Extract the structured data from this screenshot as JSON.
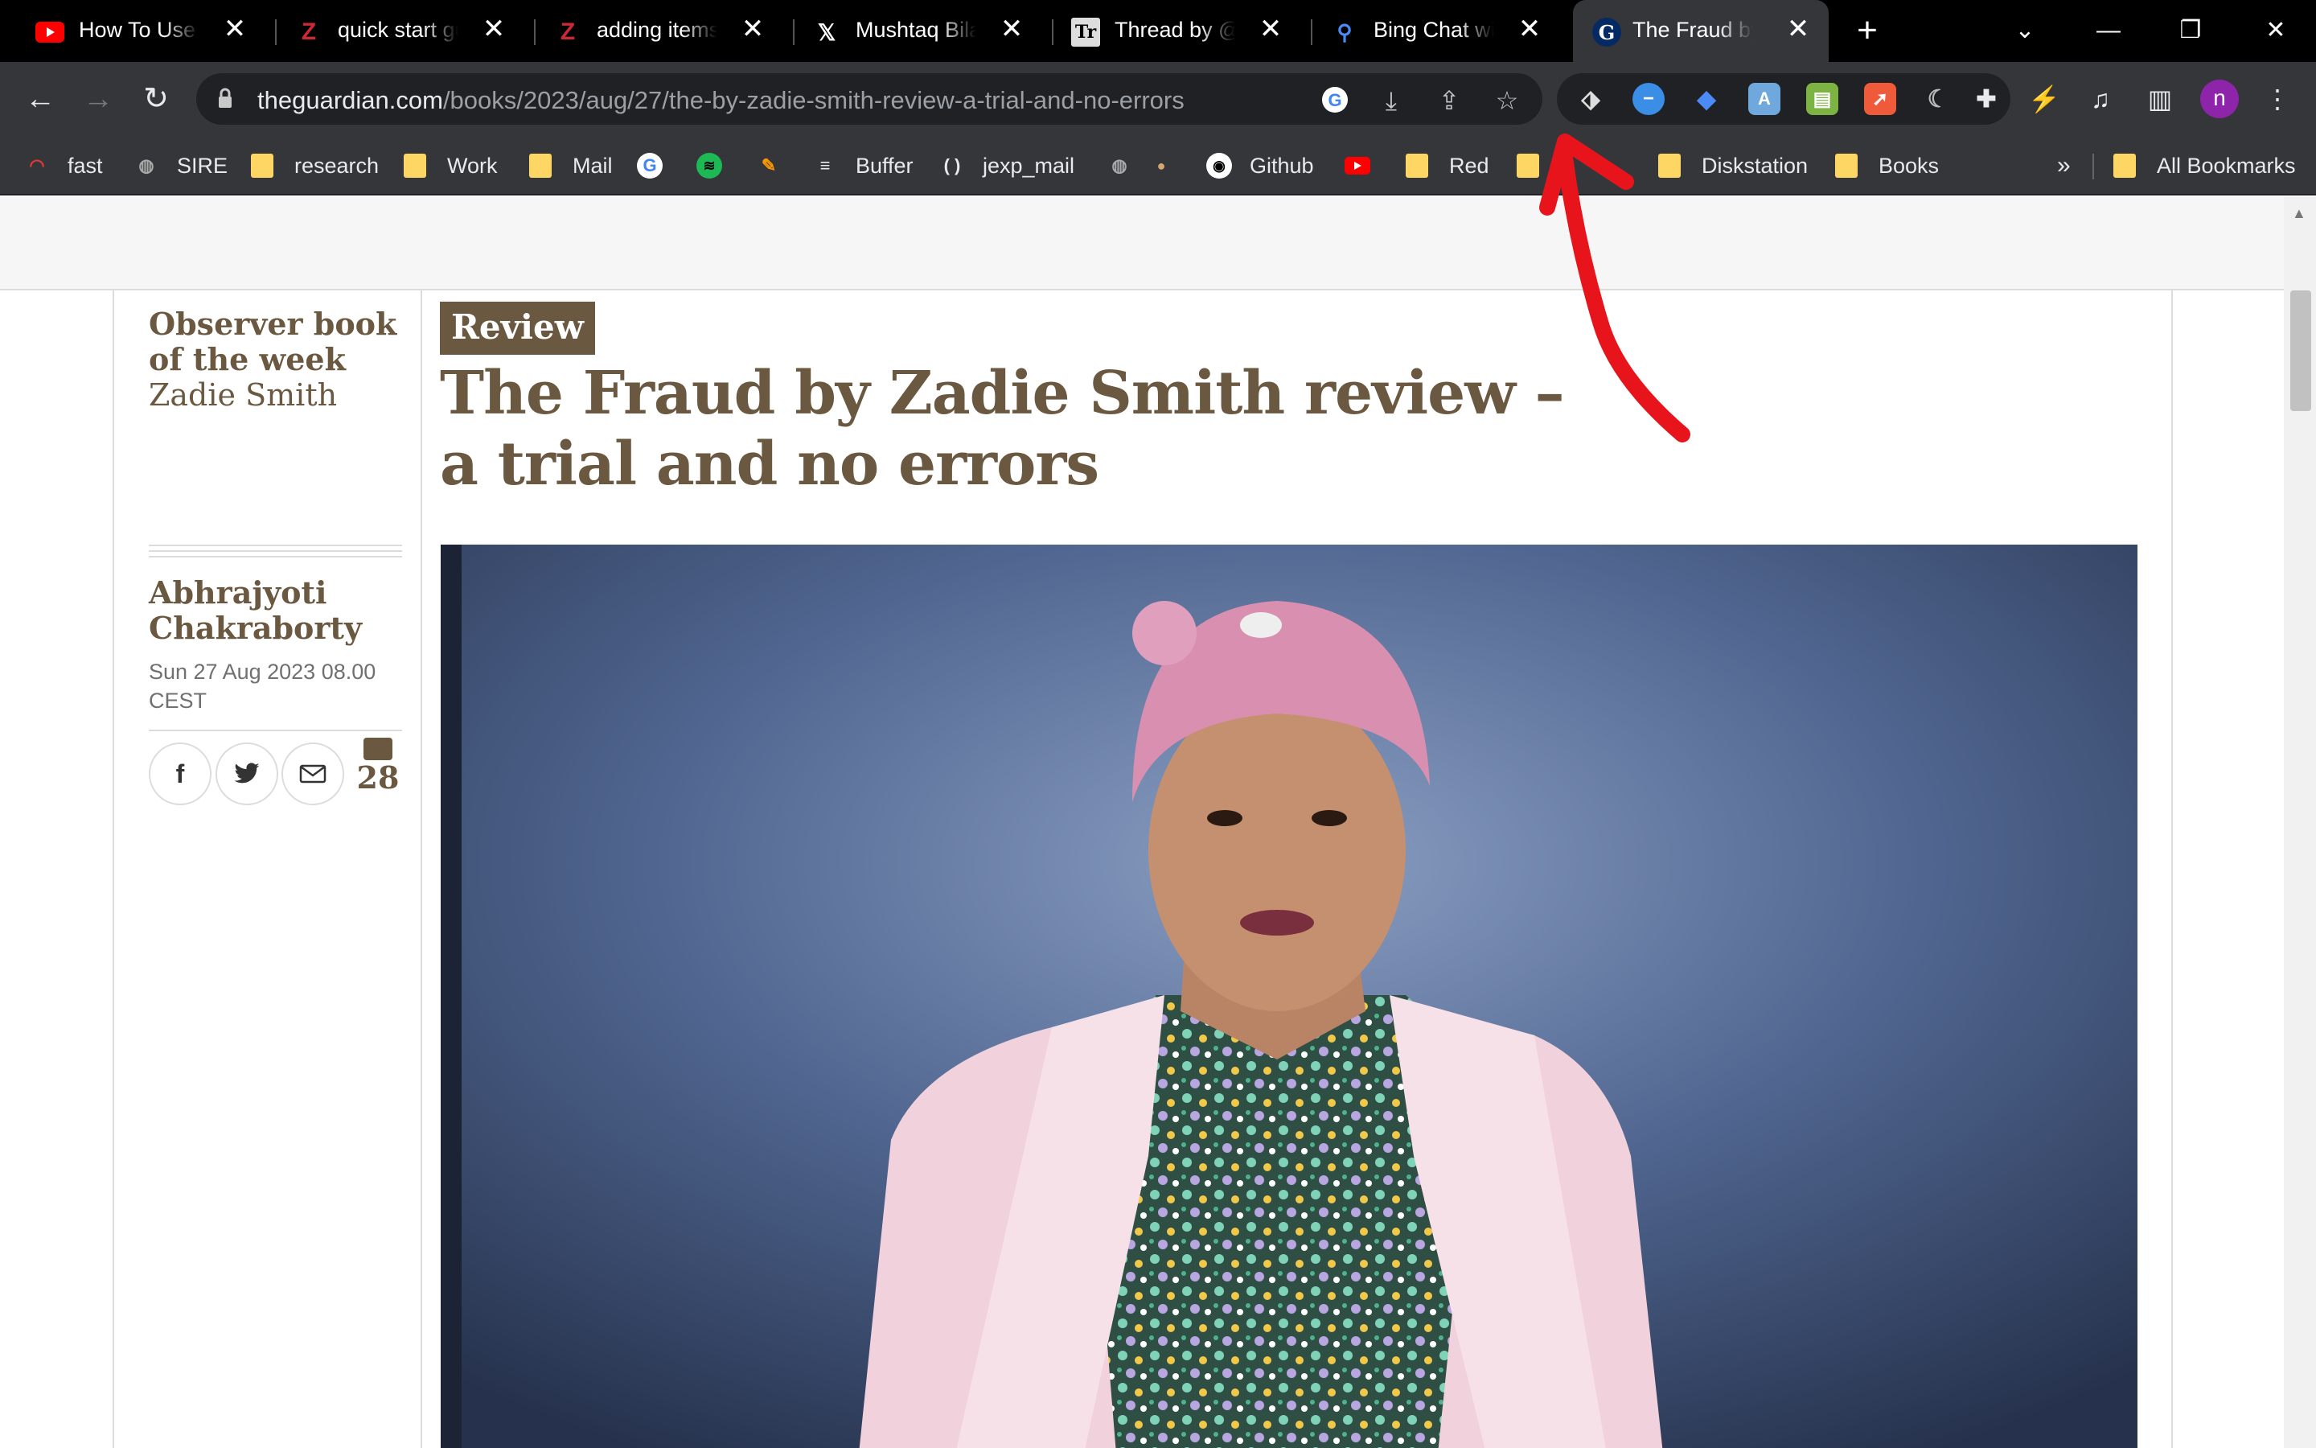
{
  "tabs": [
    {
      "title": "How To Use Zotero",
      "favicon": "youtube-icon",
      "active": false
    },
    {
      "title": "quick start guide",
      "favicon": "zotero-icon",
      "active": false
    },
    {
      "title": "adding items to",
      "favicon": "zotero-icon",
      "active": false
    },
    {
      "title": "Mushtaq Bilal,",
      "favicon": "x-icon",
      "active": false
    },
    {
      "title": "Thread by @M",
      "favicon": "threadreader-icon",
      "active": false
    },
    {
      "title": "Bing Chat with",
      "favicon": "bing-search-icon",
      "active": false
    },
    {
      "title": "The Fraud by Z",
      "favicon": "guardian-icon",
      "active": true
    }
  ],
  "address_bar": {
    "host": "theguardian.com",
    "path": "/books/2023/aug/27/the-by-zadie-smith-review-a-trial-and-no-errors"
  },
  "avatar_letter": "n",
  "bookmarks": [
    {
      "label": "fast",
      "icon": "speedometer-icon"
    },
    {
      "label": "SIRE",
      "icon": "globe-icon"
    },
    {
      "label": "research",
      "icon": "folder-icon"
    },
    {
      "label": "Work",
      "icon": "folder-icon"
    },
    {
      "label": "Mail",
      "icon": "folder-icon"
    },
    {
      "label": "",
      "icon": "google-icon"
    },
    {
      "label": "",
      "icon": "spotify-icon"
    },
    {
      "label": "",
      "icon": "pencil-icon"
    },
    {
      "label": "Buffer",
      "icon": "buffer-icon"
    },
    {
      "label": "jexp_mail",
      "icon": "brackets-icon"
    },
    {
      "label": "",
      "icon": "globe-icon"
    },
    {
      "label": "",
      "icon": "cookie-icon"
    },
    {
      "label": "Github",
      "icon": "github-icon"
    },
    {
      "label": "",
      "icon": "youtube-icon"
    },
    {
      "label": "Red",
      "icon": "folder-icon"
    },
    {
      "label": "",
      "icon": "folder-icon"
    },
    {
      "label": "Diskstation",
      "icon": "folder-icon"
    },
    {
      "label": "Books",
      "icon": "folder-icon"
    }
  ],
  "bookmarks_overflow": "»",
  "all_bookmarks": "All Bookmarks",
  "article": {
    "kicker": "Observer book of the week",
    "kicker_sub": "Zadie Smith",
    "author": "Abhrajyoti Chakraborty",
    "date": "Sun 27 Aug 2023 08.00 CEST",
    "comment_count": "28",
    "label": "Review",
    "headline": "The Fraud by Zadie Smith review – a trial and no errors"
  },
  "colors": {
    "accent": "#6b5840",
    "annotation": "#e8141c"
  }
}
